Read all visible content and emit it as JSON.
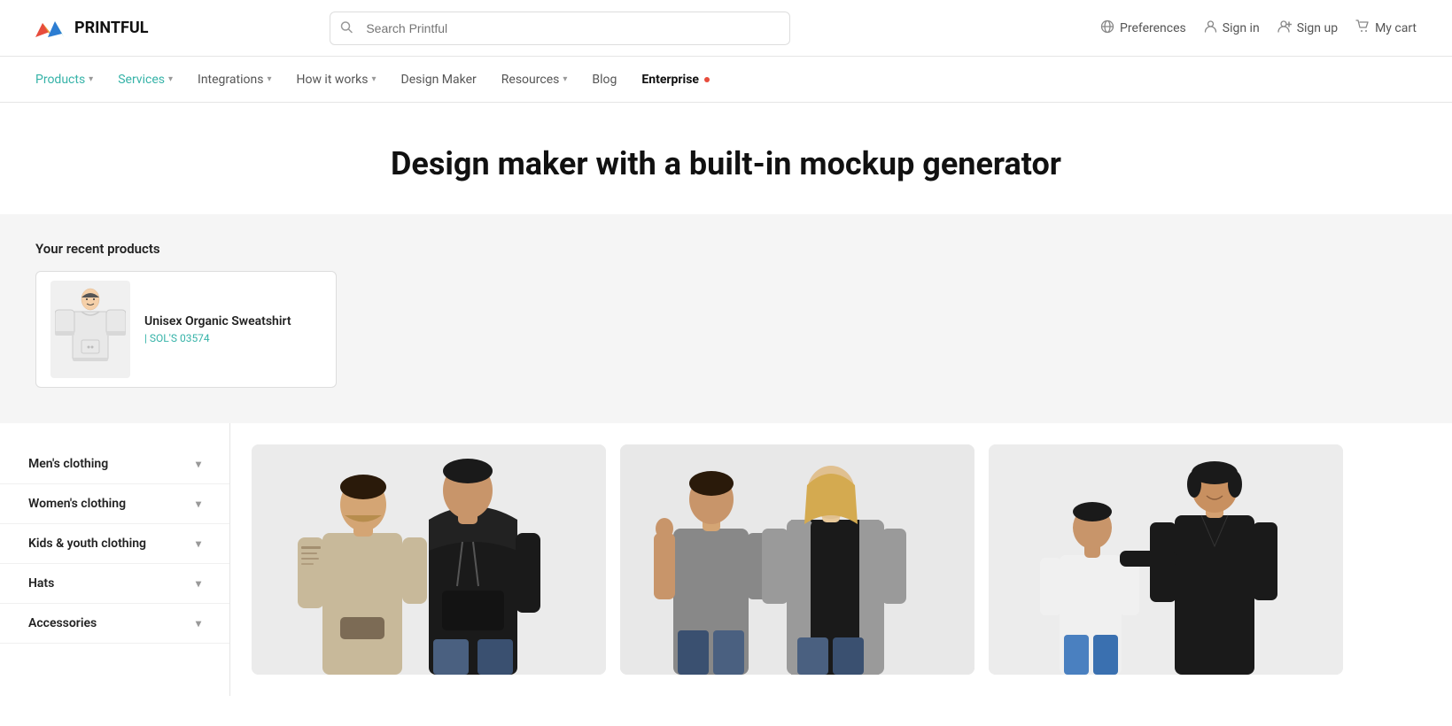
{
  "header": {
    "logo_text": "PRINTFUL",
    "search_placeholder": "Search Printful",
    "actions": [
      {
        "id": "preferences",
        "label": "Preferences",
        "icon": "globe-icon"
      },
      {
        "id": "signin",
        "label": "Sign in",
        "icon": "user-icon"
      },
      {
        "id": "signup",
        "label": "Sign up",
        "icon": "user-add-icon"
      },
      {
        "id": "cart",
        "label": "My cart",
        "icon": "cart-icon"
      }
    ]
  },
  "nav": {
    "items": [
      {
        "id": "products",
        "label": "Products",
        "has_chevron": true,
        "style": "teal"
      },
      {
        "id": "services",
        "label": "Services",
        "has_chevron": true,
        "style": "teal"
      },
      {
        "id": "integrations",
        "label": "Integrations",
        "has_chevron": true,
        "style": "normal"
      },
      {
        "id": "how-it-works",
        "label": "How it works",
        "has_chevron": true,
        "style": "normal"
      },
      {
        "id": "design-maker",
        "label": "Design Maker",
        "has_chevron": false,
        "style": "normal"
      },
      {
        "id": "resources",
        "label": "Resources",
        "has_chevron": true,
        "style": "normal"
      },
      {
        "id": "blog",
        "label": "Blog",
        "has_chevron": false,
        "style": "normal"
      },
      {
        "id": "enterprise",
        "label": "Enterprise",
        "has_chevron": false,
        "style": "bold",
        "has_dot": true
      }
    ]
  },
  "hero": {
    "title": "Design maker with a built-in mockup generator"
  },
  "recent_products": {
    "section_title": "Your recent products",
    "card": {
      "product_name": "Unisex Organic Sweatshirt",
      "sku": "| SOL'S 03574"
    }
  },
  "sidebar": {
    "items": [
      {
        "id": "mens",
        "label": "Men's clothing"
      },
      {
        "id": "womens",
        "label": "Women's clothing"
      },
      {
        "id": "kids",
        "label": "Kids & youth clothing"
      },
      {
        "id": "hats",
        "label": "Hats"
      },
      {
        "id": "accessories",
        "label": "Accessories"
      }
    ]
  },
  "product_cards": [
    {
      "id": "mens-card",
      "category": "mens"
    },
    {
      "id": "womens-card",
      "category": "womens"
    },
    {
      "id": "kids-card",
      "category": "kids"
    }
  ]
}
